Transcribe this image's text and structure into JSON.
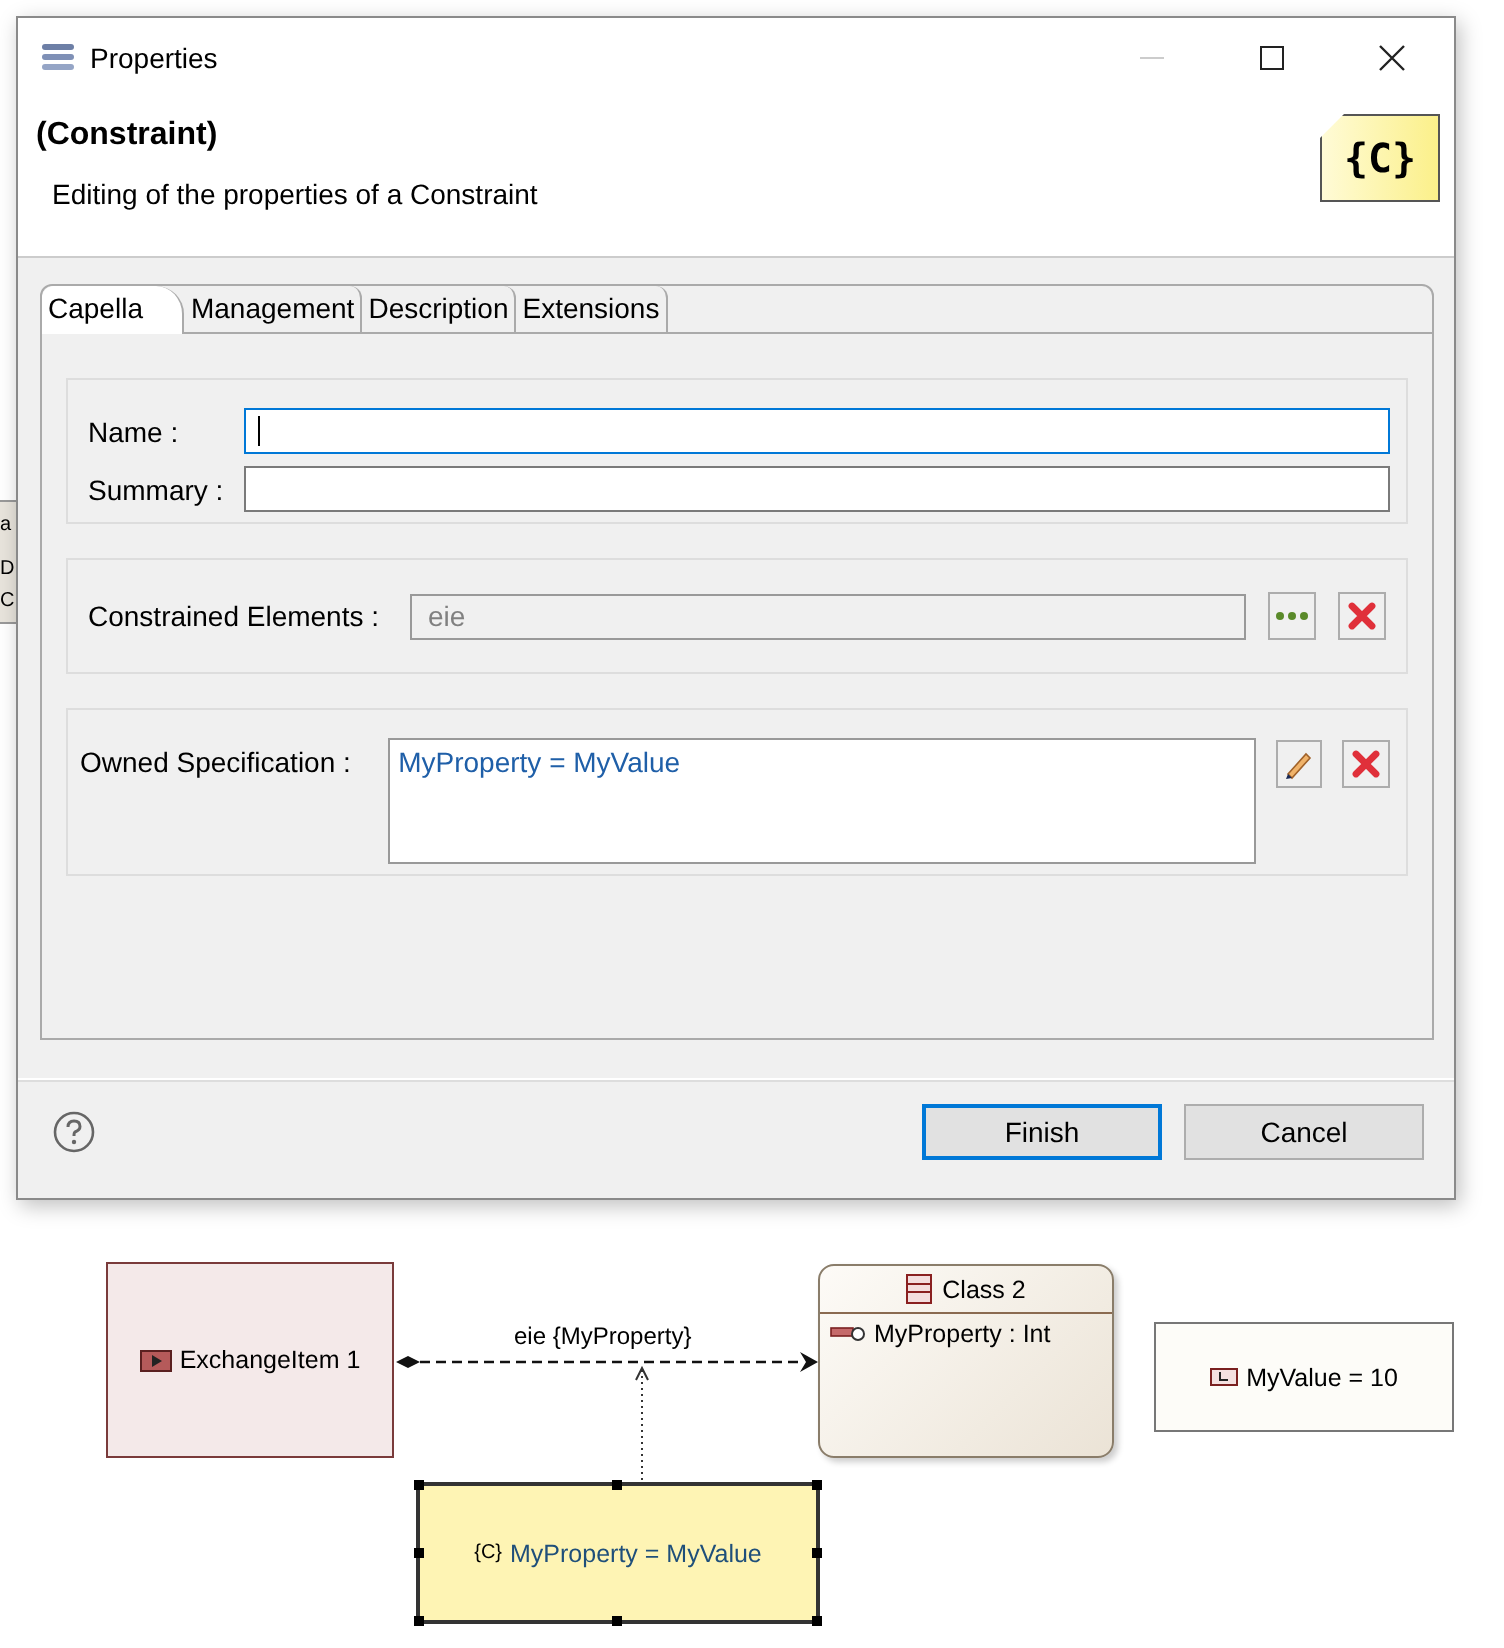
{
  "background_fragments": [
    "a",
    "D",
    "C"
  ],
  "window": {
    "title": "Properties"
  },
  "header": {
    "title": "(Constraint)",
    "subtitle": "Editing of the properties of a Constraint",
    "badge": "{C}"
  },
  "tabs": [
    {
      "label": "Capella",
      "selected": true
    },
    {
      "label": "Management",
      "selected": false
    },
    {
      "label": "Description",
      "selected": false
    },
    {
      "label": "Extensions",
      "selected": false
    }
  ],
  "sections": [
    {
      "kind": "fields",
      "fields": [
        {
          "label": "Name :",
          "focused": true
        },
        {
          "label": "Summary :",
          "focused": false
        }
      ]
    },
    {
      "kind": "reference",
      "label": "Constrained Elements :",
      "value": "eie",
      "disabled": true
    },
    {
      "kind": "specification",
      "label": "Owned Specification :",
      "value_parts": [
        "MyProperty",
        " = ",
        "MyValue"
      ]
    }
  ],
  "buttons": [
    {
      "label": "Finish",
      "default": true
    },
    {
      "label": "Cancel",
      "default": false
    }
  ],
  "diagram": {
    "nodes": [
      {
        "kind": "exchange_item",
        "label": "ExchangeItem 1",
        "selected": false
      },
      {
        "kind": "class",
        "label": "Class 2",
        "properties": [
          "MyProperty : Int"
        ],
        "selected": false
      },
      {
        "kind": "value",
        "label": "MyValue = 10",
        "selected": false
      },
      {
        "kind": "constraint",
        "tag": "{C}",
        "label": "MyProperty = MyValue",
        "selected": true
      }
    ],
    "edge_label": "eie {MyProperty}"
  }
}
